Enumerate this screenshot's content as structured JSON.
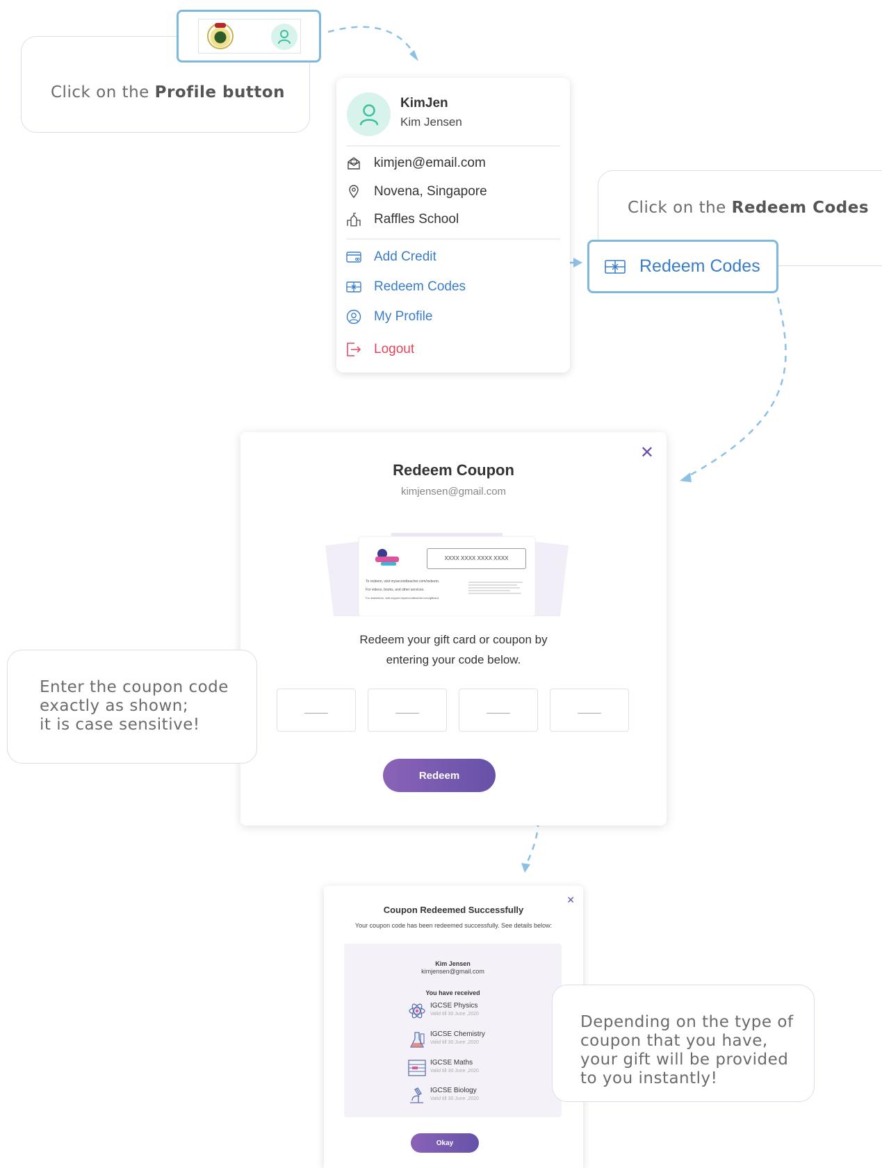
{
  "callouts": {
    "profile": {
      "prefix": "Click on the ",
      "bold": "Profile button"
    },
    "redeem": {
      "prefix": "Click on the ",
      "bold": "Redeem Codes"
    },
    "enter_code": {
      "line1": "Enter the coupon code",
      "line2": "exactly as shown;",
      "line3": "it is case sensitive!"
    },
    "gift": {
      "line1": "Depending on the type of",
      "line2": "coupon that you have,",
      "line3": "your gift will be provided",
      "line4": "to you instantly!"
    }
  },
  "profile_menu": {
    "username": "KimJen",
    "fullname": "Kim Jensen",
    "email": "kimjen@email.com",
    "location": "Novena, Singapore",
    "school": "Raffles School",
    "items": [
      {
        "label": "Add Credit",
        "icon": "credit-card-icon"
      },
      {
        "label": "Redeem Codes",
        "icon": "gift-card-icon"
      },
      {
        "label": "My Profile",
        "icon": "user-circle-icon"
      },
      {
        "label": "Logout",
        "icon": "logout-icon"
      }
    ]
  },
  "redeem_highlight": {
    "label": "Redeem Codes"
  },
  "coupon_modal": {
    "title": "Redeem Coupon",
    "email": "kimjensen@gmail.com",
    "card": {
      "brand": "Second Teacher",
      "code_placeholder": "XXXX XXXX XXXX XXXX",
      "line1": "To redeem, visit mysecondteacher.com/redeem.",
      "line2": "For videos, books, and other services.",
      "line3": "For assistance, visit support.mysecondteacher.com/giftcard."
    },
    "description_line1": "Redeem your gift card or coupon by",
    "description_line2": "entering your code below.",
    "code_placeholders": [
      "____",
      "____",
      "____",
      "____"
    ],
    "redeem_label": "Redeem"
  },
  "success_modal": {
    "title": "Coupon Redeemed Successfully",
    "subtitle": "Your coupon code has been redeemed successfully. See details below:",
    "name": "Kim Jensen",
    "email": "kimjensen@gmail.com",
    "received_label": "You have received",
    "gifts": [
      {
        "name": "IGCSE Physics",
        "valid": "Valid till 30 June ,2020",
        "icon": "atom-icon"
      },
      {
        "name": "IGCSE Chemistry",
        "valid": "Valid till 30 June ,2020",
        "icon": "flask-icon"
      },
      {
        "name": "IGCSE Maths",
        "valid": "Valid till 30 June ,2020",
        "icon": "abacus-icon"
      },
      {
        "name": "IGCSE Biology",
        "valid": "Valid till 30 June ,2020",
        "icon": "microscope-icon"
      }
    ],
    "okay_label": "Okay"
  },
  "colors": {
    "accent_blue": "#3a7dc7",
    "highlight_border": "#7fb8dd",
    "logout_red": "#e0455b",
    "button_purple": "#7a5ab0",
    "avatar_bg": "#d7f3ec",
    "avatar_green": "#3cbf9c"
  }
}
